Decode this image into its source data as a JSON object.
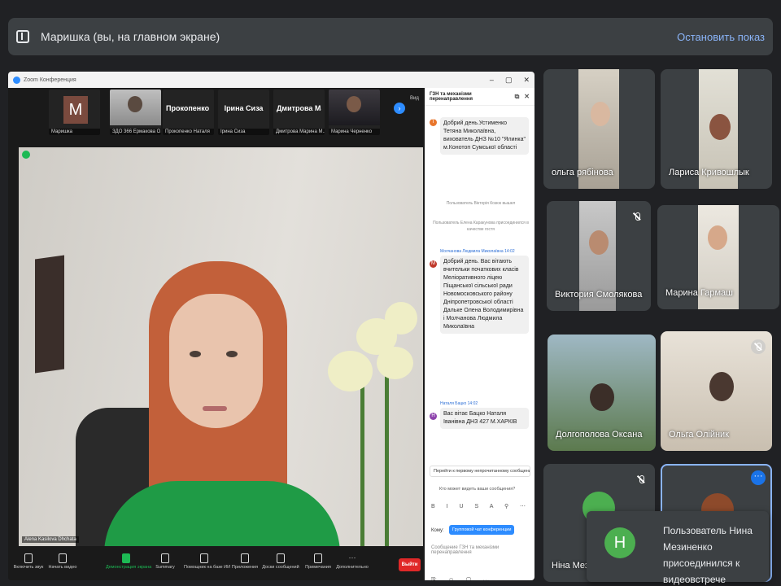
{
  "presenting": {
    "title": "Маришка (вы, на главном экране)",
    "stop_label": "Остановить показ"
  },
  "zoom": {
    "window_title": "Zoom Конференция",
    "strip": [
      {
        "big": "M",
        "name": "Маришка"
      },
      {
        "big": "",
        "name": "ЗДО 366 Ермакова О..."
      },
      {
        "big": "Прокопенко Н...",
        "name": "Прокопенко Наталя"
      },
      {
        "big": "Ірина Сиза",
        "name": "Ірина Сиза"
      },
      {
        "big": "Дмитрова Мар...",
        "name": "Дмитрова Марина М..."
      },
      {
        "big": "",
        "name": "Марина Черненко"
      }
    ],
    "view_label": "Вид",
    "speaker_name": "Alena Kasilova Dhchata",
    "chat": {
      "title": "ГЗН та механізми перенаправлення",
      "messages": [
        {
          "avatar": "T",
          "sender": "",
          "text": "Добрий день.Устименко Тетяна Миколаївна, вихователь ДНЗ №10 \"Ялинка\" м.Конотоп Сумської області"
        },
        {
          "avatar": "M",
          "sender": "Молчанова Людмила Миколаївна 14:02",
          "text": "Добрий день. Вас вітають вчительки початкових класів Меліоративного ліцею Піщанської сільської ради Новомосковського району Дніпропетровської області Дальке Олена Володимирівна і Молчанова Людмила Миколаївна"
        },
        {
          "avatar": "H",
          "sender": "Наталя Бацко 14:02",
          "text": "Вас вітає Бацко Наталя Іванівна ДНЗ 427 М.ХАРКІВ"
        }
      ],
      "system": [
        "Пользователь Вікторія Козюк вышел",
        "Пользователь Елена Каракунова присоединился в качестве гостя"
      ],
      "jump_label": "Перейти к первому непрочитанному сообщение",
      "who_sees": "Кто может видеть ваши сообщения?",
      "to_label": "Кому:",
      "to_value": "Групповой чат конференции",
      "input_placeholder": "Сообщение ГЗН та механізми перенаправлення"
    },
    "toolbar": [
      "Включить звук",
      "Начать видео",
      "Демонстрация экрана",
      "Summary",
      "Помощник на базе ИИ",
      "Приложения",
      "Доски сообщений",
      "Примечания",
      "Дополнительно"
    ],
    "leave_label": "Выйти"
  },
  "participants": [
    {
      "name": "ольга рябінова"
    },
    {
      "name": "Лариса Кривошлык"
    },
    {
      "name": "Виктория Смолякова"
    },
    {
      "name": "Марина Гармаш"
    },
    {
      "name": "Долгополова Оксана"
    },
    {
      "name": "Ольга Олійник"
    },
    {
      "name": "Ніна Мезиненко"
    },
    {
      "name": ""
    }
  ],
  "toast": {
    "avatar": "Н",
    "text": "Пользователь Нина Мезиненко присоединился к видеовстрече"
  },
  "colors": {
    "meet_bg": "#202124",
    "tile_bg": "#3c4043",
    "accent": "#8ab4f8",
    "zoom_blue": "#2d8cff",
    "zoom_green": "#1db954",
    "leave_red": "#e02828"
  }
}
